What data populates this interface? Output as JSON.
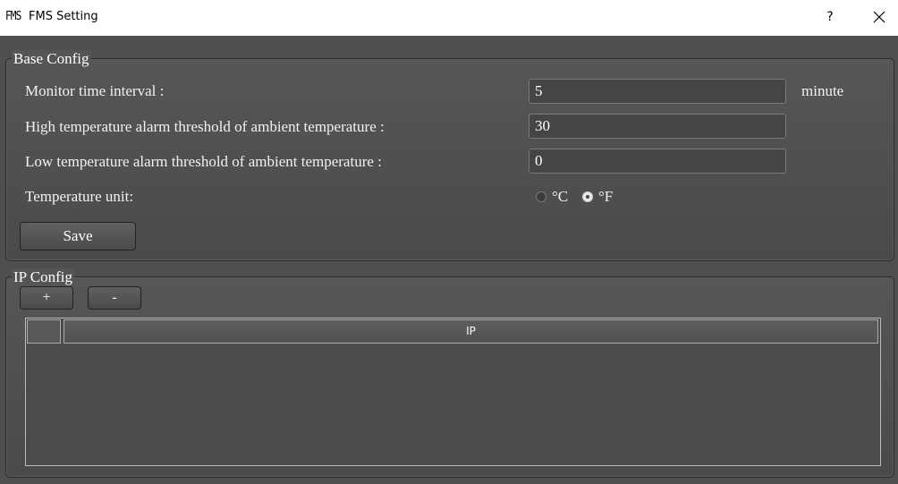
{
  "window": {
    "logo_text": "FMS",
    "title": "FMS Setting",
    "help_label": "?",
    "close_icon": "close-icon"
  },
  "base_config": {
    "title": "Base Config",
    "monitor_interval": {
      "label": "Monitor time interval :",
      "value": "5",
      "unit": "minute"
    },
    "high_temp": {
      "label": "High temperature alarm threshold of ambient temperature :",
      "value": "30"
    },
    "low_temp": {
      "label": "Low temperature alarm threshold of ambient temperature :",
      "value": "0"
    },
    "temp_unit": {
      "label": "Temperature unit:",
      "options": [
        {
          "label": "°C",
          "selected": false
        },
        {
          "label": "°F",
          "selected": true
        }
      ]
    },
    "save_label": "Save"
  },
  "ip_config": {
    "title": "IP Config",
    "add_label": "+",
    "remove_label": "-",
    "table": {
      "columns": [
        "IP"
      ],
      "rows": []
    }
  }
}
